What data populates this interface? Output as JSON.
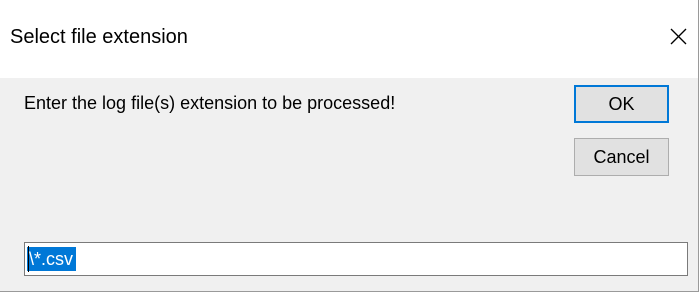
{
  "window": {
    "title": "Select file extension"
  },
  "prompt": "Enter the log file(s) extension to be processed!",
  "buttons": {
    "ok": "OK",
    "cancel": "Cancel"
  },
  "input": {
    "value": "\\*.csv",
    "selected": true
  },
  "icons": {
    "close": "close-icon"
  },
  "colors": {
    "accent": "#0078d7",
    "dialog_bg": "#f0f0f0",
    "titlebar_bg": "#ffffff"
  }
}
